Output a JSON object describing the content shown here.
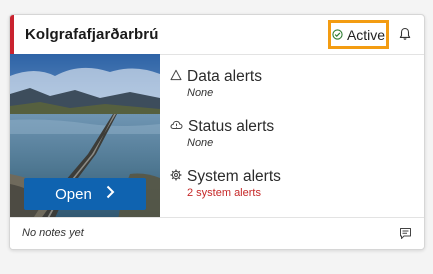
{
  "card": {
    "title": "Kolgrafafjarðarbrú",
    "status": {
      "label": "Active",
      "icon": "check-circle-icon",
      "color": "#2e7d32"
    },
    "notification_icon": "bell-icon",
    "accent_color": "#c9232f"
  },
  "media": {
    "open_button": {
      "label": "Open",
      "icon": "chevron-right-icon",
      "color": "#0f63b0"
    }
  },
  "alerts": [
    {
      "label": "Data alerts",
      "icon": "warning-triangle-icon",
      "detail": "None"
    },
    {
      "label": "Status alerts",
      "icon": "cloud-alert-icon",
      "detail": "None"
    },
    {
      "label": "System alerts",
      "icon": "gear-icon",
      "detail": "2 system alerts",
      "detail_color": "#c62828"
    }
  ],
  "footer": {
    "notes_text": "No notes yet",
    "note_icon": "note-icon"
  }
}
